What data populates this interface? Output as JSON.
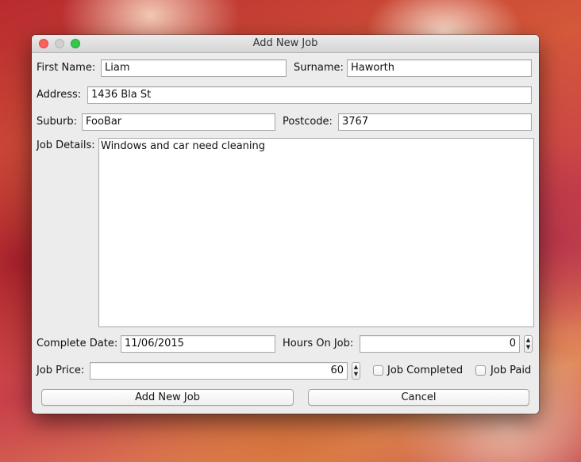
{
  "window": {
    "title": "Add New Job"
  },
  "form": {
    "first_name_label": "First Name:",
    "first_name_value": "Liam",
    "surname_label": "Surname:",
    "surname_value": "Haworth",
    "address_label": "Address:",
    "address_value": "1436 Bla St",
    "suburb_label": "Suburb:",
    "suburb_value": "FooBar",
    "postcode_label": "Postcode:",
    "postcode_value": "3767",
    "job_details_label": "Job Details:",
    "job_details_value": "Windows and car need cleaning",
    "complete_date_label": "Complete Date:",
    "complete_date_value": "11/06/2015",
    "hours_label": "Hours On Job:",
    "hours_value": "0",
    "price_label": "Job Price:",
    "price_value": "60",
    "job_completed_label": "Job Completed",
    "job_completed_checked": false,
    "job_paid_label": "Job Paid",
    "job_paid_checked": false
  },
  "buttons": {
    "add_label": "Add New Job",
    "cancel_label": "Cancel"
  },
  "icons": {
    "stepper_up": "▲",
    "stepper_down": "▼"
  },
  "colors": {
    "close": "#fc605c",
    "minimize": "#cfcfcf",
    "zoom": "#34c84a"
  }
}
